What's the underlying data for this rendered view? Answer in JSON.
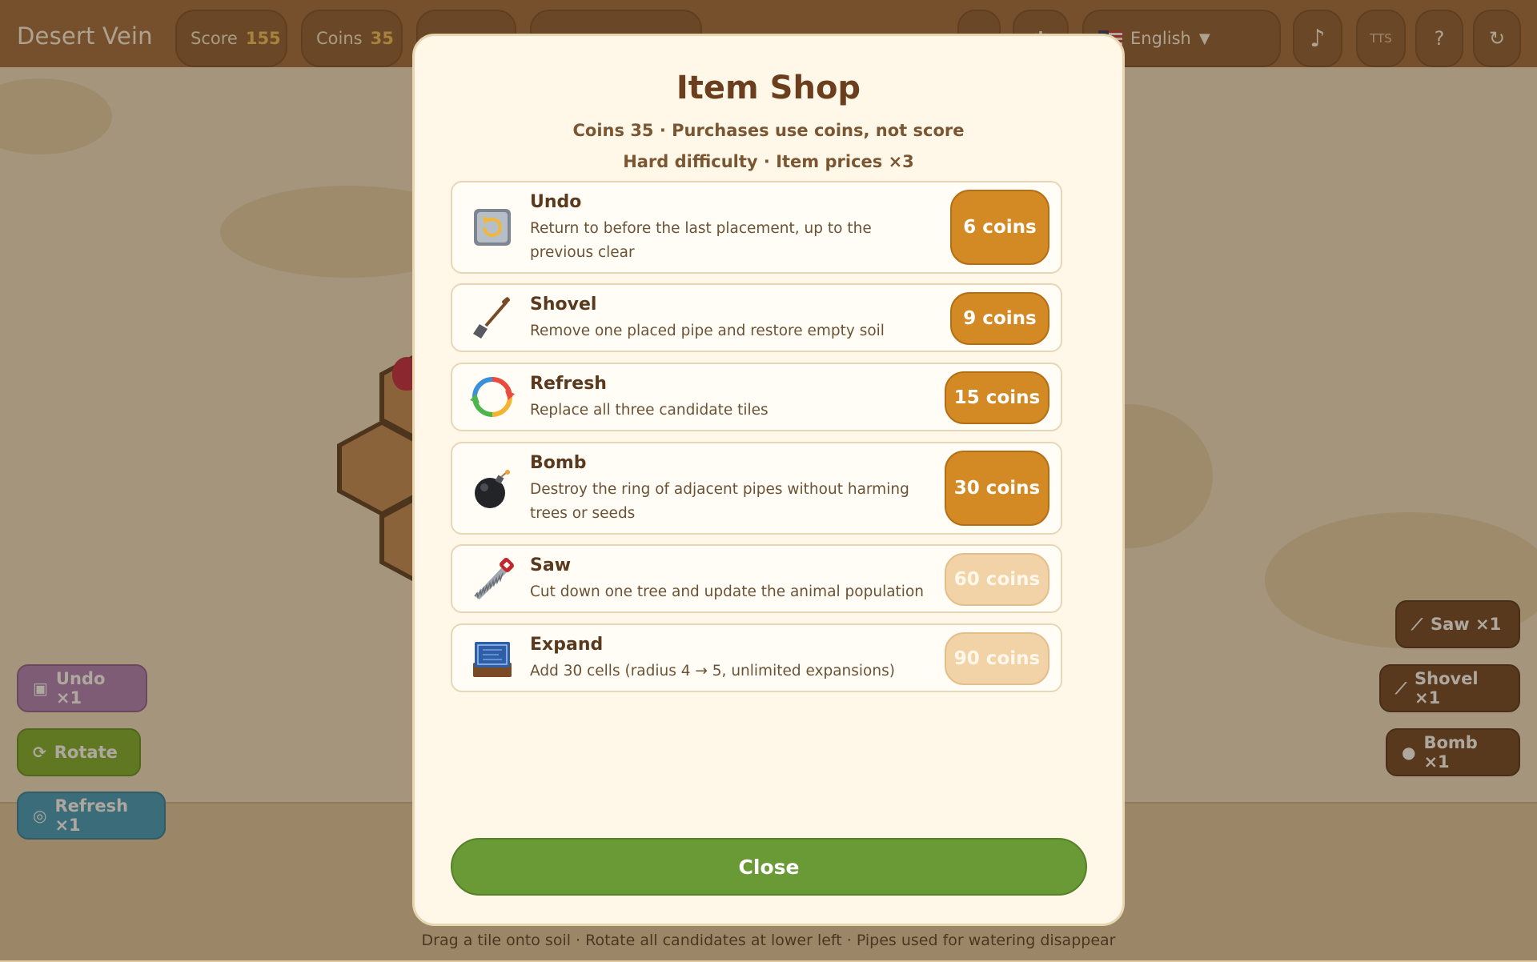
{
  "header": {
    "app_title": "Desert Vein",
    "score_label": "Score",
    "score_value": "155",
    "coins_label": "Coins",
    "coins_value": "35",
    "language": "English",
    "language_caret": "▼",
    "music_icon": "♪",
    "tts_label": "TTS",
    "help_label": "?",
    "restart_icon": "↻"
  },
  "left_actions": {
    "undo": "Undo ×1",
    "rotate": "Rotate",
    "rotate_icon": "⟳",
    "refresh": "Refresh ×1"
  },
  "right_actions": {
    "saw": "Saw ×1",
    "shovel": "Shovel ×1",
    "bomb": "Bomb ×1"
  },
  "footer_hint": "Drag a tile onto soil · Rotate all candidates at lower left · Pipes used for watering disappear",
  "shop": {
    "title": "Item Shop",
    "subtitle_coins": "Coins 35 · Purchases use coins, not score",
    "subtitle_difficulty": "Hard difficulty · Item prices ×3",
    "items": [
      {
        "name": "Undo",
        "description": "Return to before the last placement, up to the previous clear",
        "price": "6 coins",
        "icon": "undo-icon",
        "affordable": true
      },
      {
        "name": "Shovel",
        "description": "Remove one placed pipe and restore empty soil",
        "price": "9 coins",
        "icon": "shovel-icon",
        "affordable": true
      },
      {
        "name": "Refresh",
        "description": "Replace all three candidate tiles",
        "price": "15 coins",
        "icon": "refresh-icon",
        "affordable": true
      },
      {
        "name": "Bomb",
        "description": "Destroy the ring of adjacent pipes without harming trees or seeds",
        "price": "30 coins",
        "icon": "bomb-icon",
        "affordable": true
      },
      {
        "name": "Saw",
        "description": "Cut down one tree and update the animal population",
        "price": "60 coins",
        "icon": "saw-icon",
        "affordable": false
      },
      {
        "name": "Expand",
        "description": "Add 30 cells (radius 4 → 5, unlimited expansions)",
        "price": "90 coins",
        "icon": "expand-icon",
        "affordable": false
      }
    ],
    "close_label": "Close"
  },
  "colors": {
    "accent_orange": "#d38a25",
    "close_green": "#6a9a36",
    "topbar_brown": "#a06a3c"
  }
}
